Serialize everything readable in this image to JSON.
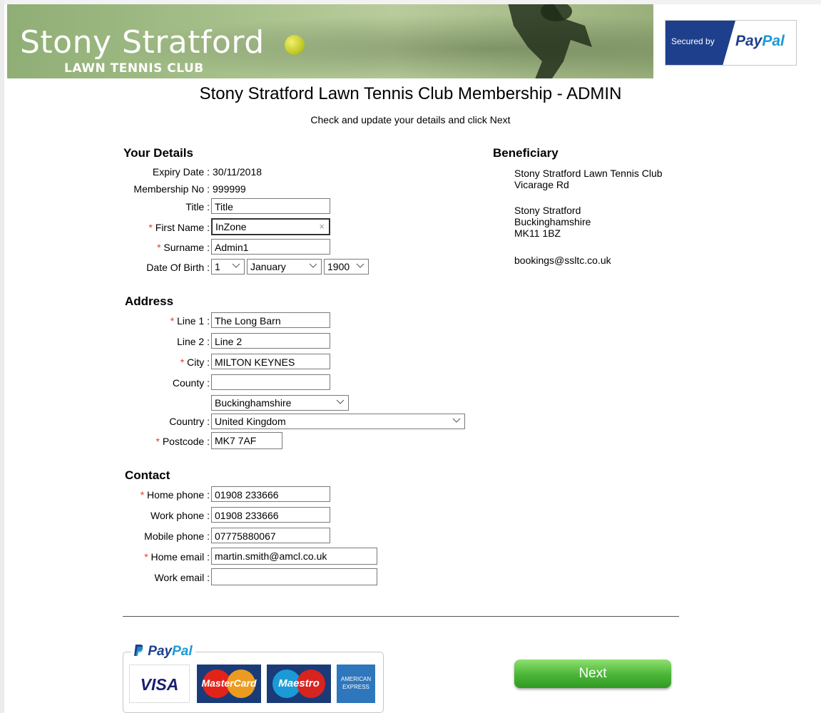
{
  "header": {
    "brand_main": "Stony Stratford",
    "brand_sub": "LAWN TENNIS CLUB",
    "secured_by": "Secured by",
    "paypal_word_a": "Pay",
    "paypal_word_b": "Pal"
  },
  "page": {
    "title": "Stony Stratford Lawn Tennis Club Membership - ADMIN",
    "subtitle": "Check and update your details and click Next"
  },
  "details": {
    "heading": "Your Details",
    "expiry_label": "Expiry Date :",
    "expiry_value": "30/11/2018",
    "membership_label": "Membership No :",
    "membership_value": "999999",
    "title_label": "Title :",
    "title_value": "Title",
    "first_name_label": "First Name :",
    "first_name_value": "InZone",
    "surname_label": "Surname :",
    "surname_value": "Admin1",
    "dob_label": "Date Of Birth :",
    "dob_day": "1",
    "dob_month": "January",
    "dob_year": "1900",
    "required_mark": "*"
  },
  "address": {
    "heading": "Address",
    "line1_label": "Line 1 :",
    "line1_value": "The Long Barn",
    "line2_label": "Line 2 :",
    "line2_value": "Line 2",
    "city_label": "City :",
    "city_value": "MILTON KEYNES",
    "county_label": "County :",
    "county_value": "",
    "county_select": "Buckinghamshire",
    "country_label": "Country :",
    "country_value": "United Kingdom",
    "postcode_label": "Postcode :",
    "postcode_value": "MK7 7AF"
  },
  "contact": {
    "heading": "Contact",
    "home_phone_label": "Home phone :",
    "home_phone_value": "01908 233666",
    "work_phone_label": "Work phone :",
    "work_phone_value": "01908 233666",
    "mobile_phone_label": "Mobile phone :",
    "mobile_phone_value": "07775880067",
    "home_email_label": "Home email :",
    "home_email_value": "martin.smith@amcl.co.uk",
    "work_email_label": "Work email :",
    "work_email_value": ""
  },
  "beneficiary": {
    "heading": "Beneficiary",
    "line1": "Stony Stratford Lawn Tennis Club",
    "line2": "Vicarage Rd",
    "line3": "Stony Stratford",
    "line4": "Buckinghamshire",
    "line5": "MK11 1BZ",
    "email": "bookings@ssltc.co.uk"
  },
  "payment": {
    "paypal_logo_a": "Pay",
    "paypal_logo_b": "Pal",
    "visa": "VISA",
    "mastercard": "MasterCard",
    "maestro": "Maestro",
    "amex_line1": "AMERICAN",
    "amex_line2": "EXPRESS"
  },
  "actions": {
    "next_label": "Next"
  },
  "colors": {
    "required": "#e53a2a",
    "paypal_dark": "#1e3f8c",
    "paypal_light": "#1b9ad6",
    "next_green": "#4fb83a"
  }
}
